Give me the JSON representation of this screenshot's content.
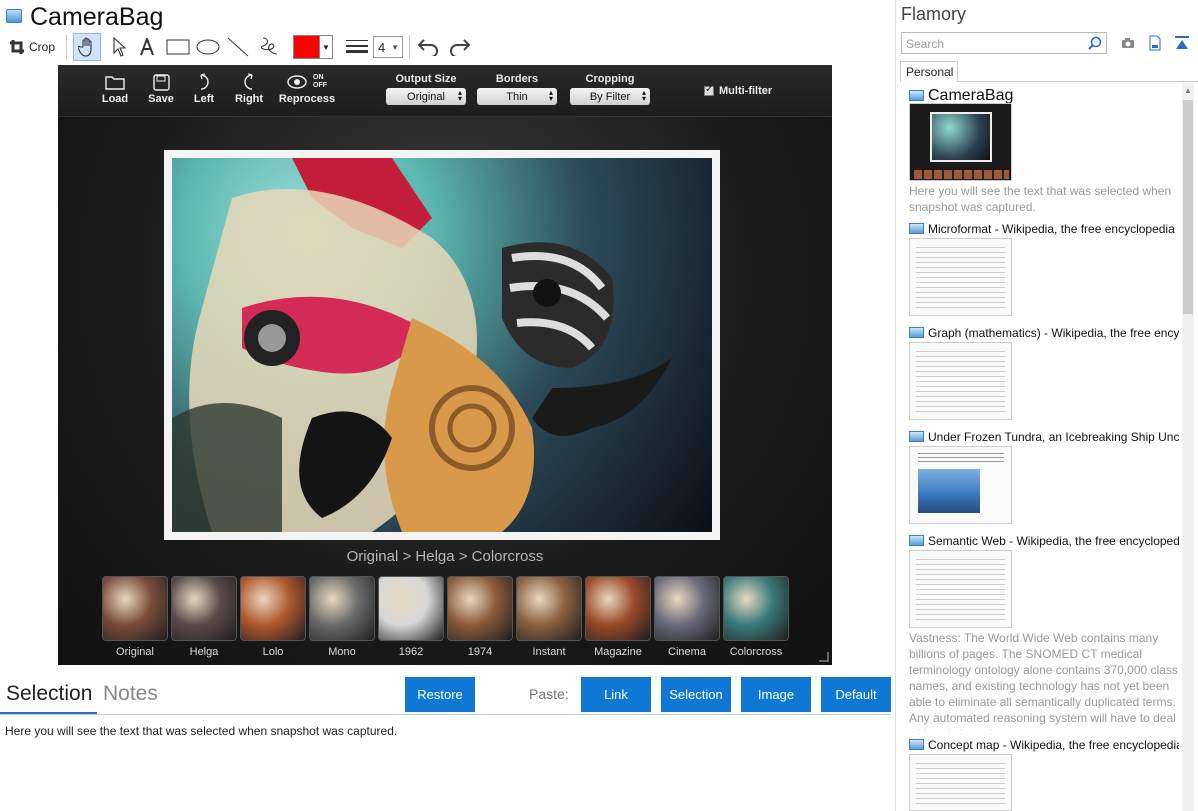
{
  "app": {
    "title": "CameraBag"
  },
  "toolbar": {
    "crop_label": "Crop",
    "line_size": "4",
    "color": "#ff0000"
  },
  "camerabag": {
    "buttons": [
      "Load",
      "Save",
      "Left",
      "Right",
      "Reprocess"
    ],
    "reprocess_on": "ON",
    "reprocess_off": "OFF",
    "output_size": {
      "label": "Output Size",
      "value": "Original"
    },
    "borders": {
      "label": "Borders",
      "value": "Thin"
    },
    "cropping": {
      "label": "Cropping",
      "value": "By Filter"
    },
    "multi_filter": "Multi-filter",
    "filter_path": "Original > Helga > Colorcross",
    "filters": [
      {
        "name": "Original",
        "tint": "#7a4c3c"
      },
      {
        "name": "Helga",
        "tint": "#5a4a4a"
      },
      {
        "name": "Lolo",
        "tint": "#b0582e"
      },
      {
        "name": "Mono",
        "tint": "#6b6b6b"
      },
      {
        "name": "1962",
        "tint": "#d8d8d8"
      },
      {
        "name": "1974",
        "tint": "#8a5a3a"
      },
      {
        "name": "Instant",
        "tint": "#8a6040"
      },
      {
        "name": "Magazine",
        "tint": "#9a4a2a"
      },
      {
        "name": "Cinema",
        "tint": "#6a6a7a"
      },
      {
        "name": "Colorcross",
        "tint": "#3a7a7a"
      }
    ]
  },
  "bottom": {
    "tabs": [
      "Selection",
      "Notes"
    ],
    "restore": "Restore",
    "paste_label": "Paste:",
    "paste_buttons": [
      "Link",
      "Selection",
      "Image",
      "Default"
    ],
    "selection_text": "Here you will see the text that was selected when snapshot was captured."
  },
  "sidebar": {
    "title": "Flamory",
    "search_placeholder": "Search",
    "tab": "Personal",
    "items": [
      {
        "title": "CameraBag",
        "desc": "Here you will see the text that was selected when snapshot was captured."
      },
      {
        "title": "Microformat - Wikipedia, the free encyclopedia"
      },
      {
        "title": "Graph (mathematics) - Wikipedia, the free ency"
      },
      {
        "title": "Under Frozen Tundra, an Icebreaking Ship Unco"
      },
      {
        "title": "Semantic Web - Wikipedia, the free encycloped",
        "desc": "Vastness: The World Wide Web contains many billions of pages. The SNOMED CT medical terminology ontology alone contains 370,000 class names, and existing technology has not yet been able to eliminate all semantically duplicated terms. Any automated reasoning system will have to deal with truly huge inputs."
      },
      {
        "title": "Concept map - Wikipedia, the free encyclopedia"
      }
    ]
  }
}
